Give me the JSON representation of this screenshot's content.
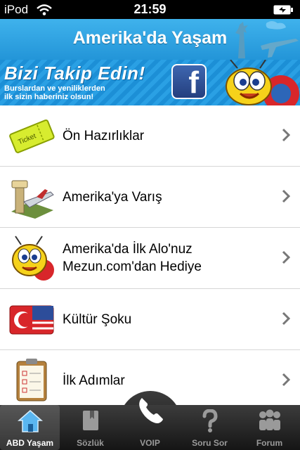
{
  "status": {
    "carrier": "iPod",
    "time": "21:59"
  },
  "nav": {
    "title": "Amerika'da Yaşam"
  },
  "banner": {
    "headline": "Bizi Takip Edin!",
    "sub_line1": "Burslardan ve yeniliklerden",
    "sub_line2": "ilk sizin haberiniz olsun!",
    "fb_letter": "f",
    "ticket_text": "Ticket"
  },
  "list": [
    {
      "label": "Ön Hazırlıklar",
      "icon": "ticket-icon"
    },
    {
      "label": "Amerika'ya Varış",
      "icon": "airport-icon"
    },
    {
      "label": "Amerika'da İlk Alo'nuz Mezun.com'dan Hediye",
      "icon": "bee-mascot-icon"
    },
    {
      "label": "Kültür Şoku",
      "icon": "flag-icon"
    },
    {
      "label": "İlk Adımlar",
      "icon": "clipboard-icon"
    }
  ],
  "tabs": [
    {
      "label": "ABD Yaşam",
      "icon": "home-icon",
      "active": true
    },
    {
      "label": "Sözlük",
      "icon": "dictionary-icon"
    },
    {
      "label": "VOIP",
      "icon": "phone-icon"
    },
    {
      "label": "Soru Sor",
      "icon": "question-icon"
    },
    {
      "label": "Forum",
      "icon": "forum-icon"
    }
  ],
  "colors": {
    "nav_blue": "#2aa3e4",
    "banner_blue": "#1c8fd6",
    "tabbar": "#1e1e1e"
  }
}
